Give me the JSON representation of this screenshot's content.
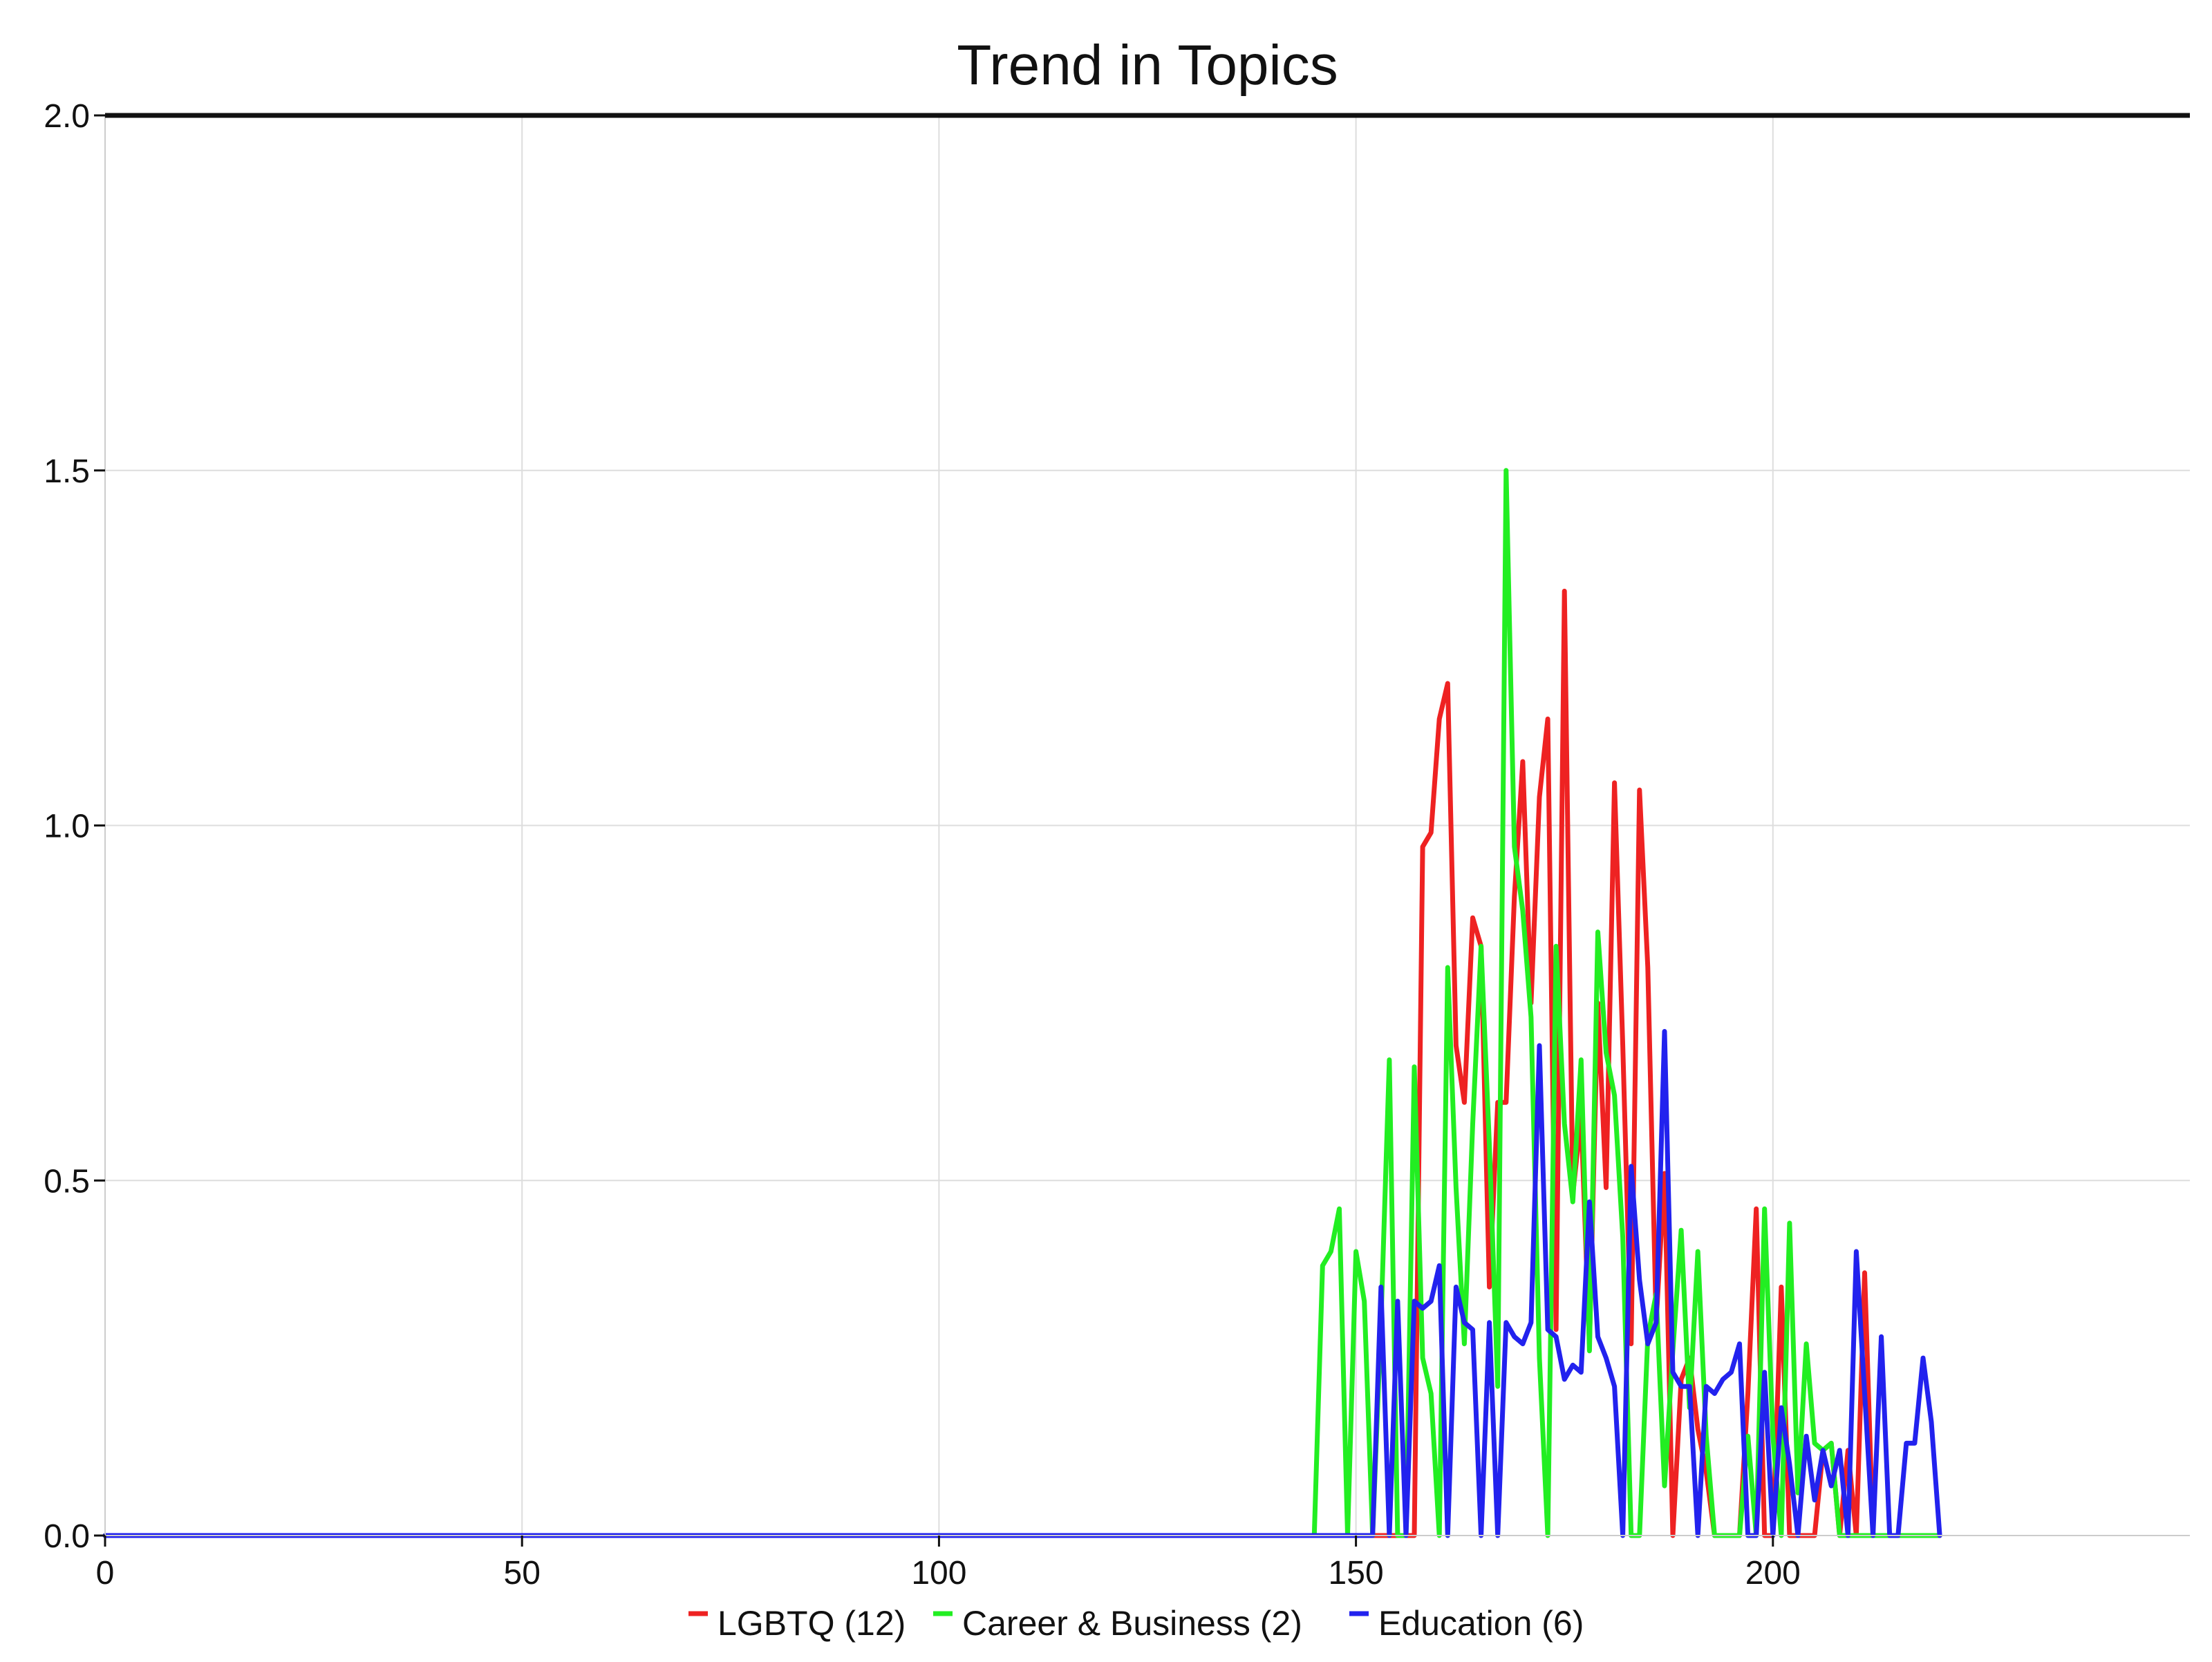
{
  "chart_data": {
    "type": "line",
    "title": "Trend in Topics",
    "xlabel": "",
    "ylabel": "",
    "xlim": [
      0,
      250
    ],
    "ylim": [
      0,
      2.0
    ],
    "x_ticks": [
      0,
      50,
      100,
      150,
      200
    ],
    "x_tick_labels": [
      "0",
      "50",
      "100",
      "150",
      "200"
    ],
    "y_ticks": [
      0.0,
      0.5,
      1.0,
      1.5,
      2.0
    ],
    "y_tick_labels": [
      "0.0",
      "0.5",
      "1.0",
      "1.5",
      "2.0"
    ],
    "grid": true,
    "legend_position": "bottom",
    "series": [
      {
        "name": "LGBTQ (12)",
        "color": "#ee2222",
        "x": [
          0,
          152,
          156,
          157,
          158,
          159,
          160,
          161,
          162,
          163,
          164,
          165,
          166,
          167,
          168,
          169,
          170,
          171,
          172,
          173,
          174,
          175,
          176,
          177,
          178,
          179,
          180,
          181,
          182,
          183,
          184,
          185,
          186,
          187,
          188,
          189,
          190,
          191,
          192,
          193,
          194,
          195,
          196,
          197,
          198,
          199,
          200,
          201,
          202,
          203,
          204,
          205,
          206,
          207,
          208,
          209,
          210,
          211,
          212,
          213,
          220
        ],
        "y": [
          0,
          0,
          0,
          0,
          0.97,
          0.99,
          1.15,
          1.2,
          0.69,
          0.61,
          0.87,
          0.83,
          0.35,
          0.61,
          0.61,
          0.9,
          1.09,
          0.75,
          1.04,
          1.15,
          0.29,
          1.33,
          0.48,
          0.59,
          0.27,
          0.75,
          0.49,
          1.06,
          0.69,
          0.27,
          1.05,
          0.8,
          0.3,
          0.51,
          0,
          0.22,
          0.25,
          0.15,
          0.09,
          0,
          0,
          0,
          0,
          0.2,
          0.46,
          0,
          0,
          0.35,
          0,
          0,
          0,
          0,
          0.12,
          0.13,
          0,
          0.12,
          0,
          0.37,
          0,
          0,
          0
        ]
      },
      {
        "name": "Career & Business (2)",
        "color": "#22ee22",
        "x": [
          0,
          145,
          146,
          147,
          148,
          149,
          150,
          151,
          152,
          153,
          154,
          155,
          156,
          157,
          158,
          159,
          160,
          161,
          162,
          163,
          164,
          165,
          166,
          167,
          168,
          169,
          170,
          171,
          172,
          173,
          174,
          175,
          176,
          177,
          178,
          179,
          180,
          181,
          182,
          183,
          184,
          185,
          186,
          187,
          188,
          189,
          190,
          191,
          192,
          193,
          194,
          195,
          196,
          197,
          198,
          199,
          200,
          201,
          202,
          203,
          204,
          205,
          206,
          207,
          208,
          209,
          210,
          211,
          212,
          213,
          214,
          215,
          216,
          217,
          218,
          219,
          220
        ],
        "y": [
          0,
          0,
          0.38,
          0.4,
          0.46,
          0,
          0.4,
          0.33,
          0,
          0.3,
          0.67,
          0,
          0,
          0.66,
          0.25,
          0.2,
          0,
          0.8,
          0.49,
          0.27,
          0.58,
          0.83,
          0.55,
          0.21,
          1.5,
          0.97,
          0.88,
          0.73,
          0.25,
          0,
          0.83,
          0.58,
          0.47,
          0.67,
          0.26,
          0.85,
          0.68,
          0.62,
          0.42,
          0,
          0,
          0.28,
          0.34,
          0.07,
          0.26,
          0.43,
          0.18,
          0.4,
          0.14,
          0,
          0,
          0,
          0,
          0.14,
          0,
          0.46,
          0.14,
          0,
          0.44,
          0.06,
          0.27,
          0.13,
          0.12,
          0.13,
          0,
          0,
          0,
          0,
          0,
          0,
          0,
          0,
          0,
          0,
          0,
          0,
          0
        ]
      },
      {
        "name": "Education (6)",
        "color": "#2222ee",
        "x": [
          0,
          152,
          153,
          154,
          155,
          156,
          157,
          158,
          159,
          160,
          161,
          162,
          163,
          164,
          165,
          166,
          167,
          168,
          169,
          170,
          171,
          172,
          173,
          174,
          175,
          176,
          177,
          178,
          179,
          180,
          181,
          182,
          183,
          184,
          185,
          186,
          187,
          188,
          189,
          190,
          191,
          192,
          193,
          194,
          195,
          196,
          197,
          198,
          199,
          200,
          201,
          202,
          203,
          204,
          205,
          206,
          207,
          208,
          209,
          210,
          211,
          212,
          213,
          214,
          215,
          216,
          217,
          218,
          219,
          220
        ],
        "y": [
          0,
          0,
          0.35,
          0,
          0.33,
          0,
          0.33,
          0.32,
          0.33,
          0.38,
          0,
          0.35,
          0.3,
          0.29,
          0,
          0.3,
          0,
          0.3,
          0.28,
          0.27,
          0.3,
          0.69,
          0.29,
          0.28,
          0.22,
          0.24,
          0.23,
          0.47,
          0.28,
          0.25,
          0.21,
          0,
          0.52,
          0.36,
          0.27,
          0.3,
          0.71,
          0.23,
          0.21,
          0.21,
          0,
          0.21,
          0.2,
          0.22,
          0.23,
          0.27,
          0,
          0,
          0.23,
          0,
          0.18,
          0.1,
          0,
          0.14,
          0.05,
          0.12,
          0.07,
          0.12,
          0,
          0.4,
          0.2,
          0,
          0.28,
          0,
          0,
          0.13,
          0.13,
          0.25,
          0.16,
          0
        ]
      }
    ]
  }
}
